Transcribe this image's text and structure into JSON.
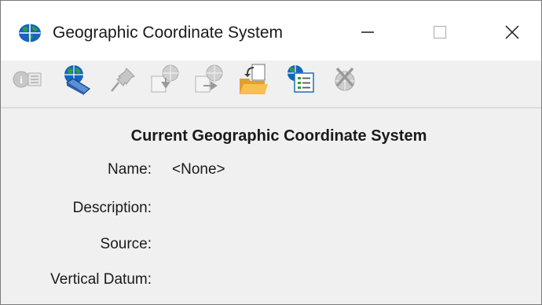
{
  "window": {
    "title": "Geographic Coordinate System",
    "minimize_glyph": "—",
    "maximize_glyph": "☐",
    "close_glyph": "✕"
  },
  "toolbar": {
    "buttons": [
      {
        "icon": "info-icon",
        "enabled": false
      },
      {
        "icon": "globe-database-icon",
        "enabled": true
      },
      {
        "icon": "pushpin-icon",
        "enabled": false
      },
      {
        "icon": "globe-import-icon",
        "enabled": false
      },
      {
        "icon": "globe-export-icon",
        "enabled": false
      },
      {
        "icon": "folder-open-icon",
        "enabled": true
      },
      {
        "icon": "globe-list-icon",
        "enabled": true
      },
      {
        "icon": "globe-delete-icon",
        "enabled": false
      }
    ]
  },
  "content": {
    "heading": "Current Geographic Coordinate System",
    "fields": [
      {
        "label": "Name:",
        "value": "<None>"
      },
      {
        "label": "Description:",
        "value": ""
      },
      {
        "label": "Source:",
        "value": ""
      },
      {
        "label": "Vertical Datum:",
        "value": ""
      }
    ]
  },
  "colors": {
    "globe_blue": "#1565c0",
    "globe_green": "#2e9e3e",
    "folder_yellow": "#f4b93c",
    "disabled_gray": "#b4b4b4"
  }
}
